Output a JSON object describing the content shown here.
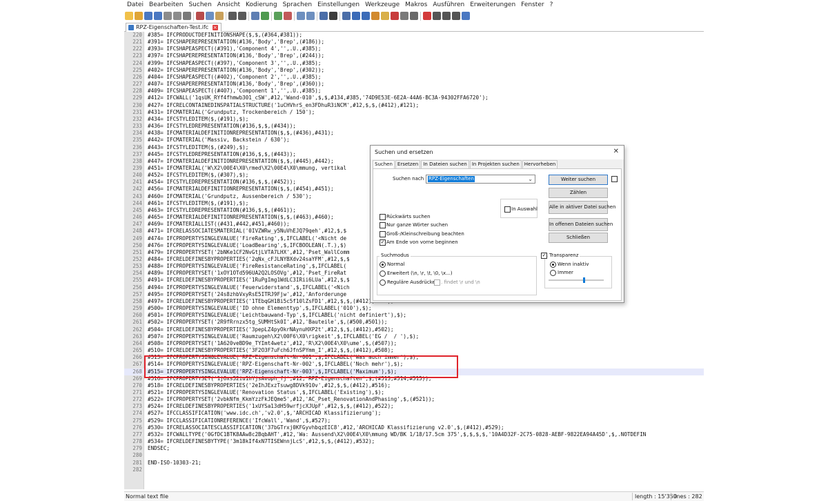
{
  "menubar": [
    "Datei",
    "Bearbeiten",
    "Suchen",
    "Ansicht",
    "Kodierung",
    "Sprachen",
    "Einstellungen",
    "Werkzeuge",
    "Makros",
    "Ausführen",
    "Erweiterungen",
    "Fenster",
    "?"
  ],
  "toolbar_icons": [
    {
      "name": "new-file-icon",
      "color": "#f1c14a"
    },
    {
      "name": "open-file-icon",
      "color": "#e0a536"
    },
    {
      "name": "save-icon",
      "color": "#4a78c2"
    },
    {
      "name": "save-all-icon",
      "color": "#4a78c2"
    },
    {
      "name": "close-icon",
      "color": "#8c8c8c"
    },
    {
      "name": "close-all-icon",
      "color": "#8c8c8c"
    },
    {
      "name": "print-icon",
      "color": "#7a7a7a"
    },
    {
      "name": "sep"
    },
    {
      "name": "cut-icon",
      "color": "#b84c4c"
    },
    {
      "name": "copy-icon",
      "color": "#6b8fc4"
    },
    {
      "name": "paste-icon",
      "color": "#c9a05a"
    },
    {
      "name": "sep"
    },
    {
      "name": "undo-icon",
      "color": "#5a5a5a"
    },
    {
      "name": "redo-icon",
      "color": "#5a5a5a"
    },
    {
      "name": "sep"
    },
    {
      "name": "find-icon",
      "color": "#5f7fb3"
    },
    {
      "name": "replace-icon",
      "color": "#4f9a4f"
    },
    {
      "name": "sep"
    },
    {
      "name": "zoom-in-icon",
      "color": "#5aa05a"
    },
    {
      "name": "zoom-out-icon",
      "color": "#c25a5a"
    },
    {
      "name": "sep"
    },
    {
      "name": "sync-vertical-icon",
      "color": "#6d8fbf"
    },
    {
      "name": "sync-horizontal-icon",
      "color": "#6d8fbf"
    },
    {
      "name": "sep"
    },
    {
      "name": "word-wrap-icon",
      "color": "#4b6ea8"
    },
    {
      "name": "show-all-chars-icon",
      "color": "#3c3c3c"
    },
    {
      "name": "sep"
    },
    {
      "name": "indent-guide-icon",
      "color": "#4b6ea8"
    },
    {
      "name": "udl-icon",
      "color": "#3c6cb8"
    },
    {
      "name": "doc-map-icon",
      "color": "#3c6cb8"
    },
    {
      "name": "function-list-icon",
      "color": "#d28a2e"
    },
    {
      "name": "folder-workspace-icon",
      "color": "#d9b04a"
    },
    {
      "name": "monitoring-icon",
      "color": "#c83c3c"
    },
    {
      "name": "panel-icon",
      "color": "#7a7a7a"
    },
    {
      "name": "eye-icon",
      "color": "#6a6a6a"
    },
    {
      "name": "sep"
    },
    {
      "name": "record-macro-icon",
      "color": "#d33a3a"
    },
    {
      "name": "stop-record-icon",
      "color": "#555555"
    },
    {
      "name": "play-macro-icon",
      "color": "#555555"
    },
    {
      "name": "play-multiple-icon",
      "color": "#555555"
    },
    {
      "name": "save-macro-icon",
      "color": "#4a78c2"
    }
  ],
  "tab": {
    "label": "RPZ-Eigenschaften-Test.ifc"
  },
  "editor": {
    "current_line": 268,
    "highlight_text": "RPZ-Eigenschaften",
    "lines": [
      {
        "n": "220",
        "t": "#385= IFCPRODUCTDEFINITIONSHAPE($,$,(#364,#381));"
      },
      {
        "n": "221",
        "t": "#391= IFCSHAPEREPRESENTATION(#136,'Body','Brep',(#186));"
      },
      {
        "n": "222",
        "t": "#393= IFCSHAPEASPECT((#391),'Component 4','',.U.,#385);"
      },
      {
        "n": "223",
        "t": "#397= IFCSHAPEREPRESENTATION(#136,'Body','Brep',(#244));"
      },
      {
        "n": "224",
        "t": "#399= IFCSHAPEASPECT((#397),'Component 3','',.U.,#385);"
      },
      {
        "n": "225",
        "t": "#402= IFCSHAPEREPRESENTATION(#136,'Body','Brep',(#302));"
      },
      {
        "n": "226",
        "t": "#404= IFCSHAPEASPECT((#402),'Component 2','',.U.,#385);"
      },
      {
        "n": "227",
        "t": "#407= IFCSHAPEREPRESENTATION(#136,'Body','Brep',(#360));"
      },
      {
        "n": "228",
        "t": "#409= IFCSHAPEASPECT((#407),'Component 1','',.U.,#385);"
      },
      {
        "n": "229",
        "t": "#412= IFCWALL('1qsUK_RYf4fhmwb301_cSW',#12,'Wand-010',$,$,#134,#385,'74D9E53E-6E2A-44A6-BC3A-94302FFA6720');"
      },
      {
        "n": "230",
        "t": "#427= IFCRELCONTAINEDINSPATIALSTRUCTURE('1uCHVhrS_en3FDhuR3iNCM',#12,$,$,(#412),#121);"
      },
      {
        "n": "231",
        "t": "#431= IFCMATERIAL('Grundputz, Trockenbereich / 150');"
      },
      {
        "n": "232",
        "t": "#434= IFCSTYLEDITEM($,(#191),$);"
      },
      {
        "n": "233",
        "t": "#436= IFCSTYLEDREPRESENTATION(#136,$,$,(#434));"
      },
      {
        "n": "234",
        "t": "#438= IFCMATERIALDEFINITIONREPRESENTATION($,$,(#436),#431);"
      },
      {
        "n": "235",
        "t": "#442= IFCMATERIAL('Massiv, Backstein / 630');"
      },
      {
        "n": "236",
        "t": "#443= IFCSTYLEDITEM($,(#249),$);"
      },
      {
        "n": "237",
        "t": "#445= IFCSTYLEDREPRESENTATION(#136,$,$,(#443));"
      },
      {
        "n": "238",
        "t": "#447= IFCMATERIALDEFINITIONREPRESENTATION($,$,(#445),#442);"
      },
      {
        "n": "239",
        "t": "#451= IFCMATERIAL('W\\X2\\00E4\\X0\\rmed\\X2\\00E4\\X0\\mmung, vertikal"
      },
      {
        "n": "240",
        "t": "#452= IFCSTYLEDITEM($,(#307),$);"
      },
      {
        "n": "241",
        "t": "#454= IFCSTYLEDREPRESENTATION(#136,$,$,(#452));"
      },
      {
        "n": "242",
        "t": "#456= IFCMATERIALDEFINITIONREPRESENTATION($,$,(#454),#451);"
      },
      {
        "n": "243",
        "t": "#460= IFCMATERIAL('Grundputz, Aussenbereich / 530');"
      },
      {
        "n": "244",
        "t": "#461= IFCSTYLEDITEM($,(#191),$);"
      },
      {
        "n": "245",
        "t": "#463= IFCSTYLEDREPRESENTATION(#136,$,$,(#461));"
      },
      {
        "n": "246",
        "t": "#465= IFCMATERIALDEFINITIONREPRESENTATION($,$,(#463),#460);"
      },
      {
        "n": "247",
        "t": "#469= IFCMATERIALLIST((#431,#442,#451,#460));"
      },
      {
        "n": "248",
        "t": "#471= IFCRELASSOCIATESMATERIAL('0IVZWRw_y5NuVhEJQ79qeh',#12,$,$"
      },
      {
        "n": "249",
        "t": "#474= IFCPROPERTYSINGLEVALUE('FireRating',$,IFCLABEL('<Nicht de"
      },
      {
        "n": "250",
        "t": "#476= IFCPROPERTYSINGLEVALUE('LoadBearing',$,IFCBOOLEAN(.T.),$)"
      },
      {
        "n": "251",
        "t": "#479= IFCPROPERTYSET('2bNKe1CF2NvGtjLVTA7LHX',#12,'Pset_WallComm"
      },
      {
        "n": "252",
        "t": "#484= IFCRELDEFINESBYPROPERTIES('2qNx_cFJLNYBXdv24saYFM',#12,$,$"
      },
      {
        "n": "253",
        "t": "#488= IFCPROPERTYSINGLEVALUE('FireResistanceRating',$,IFCLABEL("
      },
      {
        "n": "254",
        "t": "#489= IFCPROPERTYSET('1xOY1OTd596UA2Q2LOSOVg',#12,'Pset_FireRat"
      },
      {
        "n": "255",
        "t": "#491= IFCRELDEFINESBYPROPERTIES('1RuPgImg1WdLC3IRii6LUa',#12,$,$"
      },
      {
        "n": "256",
        "t": "#494= IFCPROPERTYSINGLEVALUE('Feuerwiderstand',$,IFCLABEL('<Nich"
      },
      {
        "n": "257",
        "t": "#495= IFCPROPERTYSET('24s8zhbVxyRsE5ITRJ9Fjw',#12,'Anforderunge"
      },
      {
        "n": "258",
        "t": "#497= IFCRELDEFINESBYPROPERTIES('1TEbqGH1Bi5c5f10lZsFD1',#12,$,$,(#412),#495);"
      },
      {
        "n": "259",
        "t": "#500= IFCPROPERTYSINGLEVALUE('ID ohne Elementtyp',$,IFCLABEL('010'),$);"
      },
      {
        "n": "260",
        "t": "#501= IFCPROPERTYSINGLEVALUE('Leichtbauwand-Typ',$,IFCLABEL('nicht definiert'),$);"
      },
      {
        "n": "261",
        "t": "#502= IFCPROPERTYSET('2R9fRrnzx5tg_SUMHtSk0I',#12,'Bauteile',$,(#500,#501));"
      },
      {
        "n": "262",
        "t": "#504= IFCRELDEFINESBYPROPERTIES('3pepLZ4pyOkrNAynuHXP2t',#12,$,$,(#412),#502);"
      },
      {
        "n": "263",
        "t": "#507= IFCPROPERTYSINGLEVALUE('Raumzugeh\\X2\\00F6\\X0\\rigkeit',$,IFCLABEL('EG /  / '),$);"
      },
      {
        "n": "264",
        "t": "#508= IFCPROPERTYSET('1A620veBD9e_TYImt4wetz',#12,'R\\X2\\00E4\\X0\\ume',$,(#507));"
      },
      {
        "n": "265",
        "t": "#510= IFCRELDEFINESBYPROPERTIES('3F2O3F7uFch6JfnSPYmm_I',#12,$,$,(#412),#508);"
      },
      {
        "n": "266",
        "t": "#513= IFCPROPERTYSINGLEVALUE('RPZ-Eigenschaft-Nr-001',$,IFCLABEL('Was auch immer'),$);"
      },
      {
        "n": "267",
        "t": "#514= IFCPROPERTYSINGLEVALUE('RPZ-Eigenschaft-Nr-002',$,IFCLABEL('Noch mehr'),$);"
      },
      {
        "n": "268",
        "t": "#515= IFCPROPERTYSINGLEVALUE('RPZ-Eigenschaft-Nr-003',$,IFCLABEL('Maximum'),$);"
      },
      {
        "n": "269",
        "t": "#516= IFCPROPERTYSET('1jOxs52iu1hYjsAvuph_fj',#12,'RPZ-Eigenschaften',$,(#513,#514,#515));"
      },
      {
        "n": "270",
        "t": "#518= IFCRELDEFINESBYPROPERTIES('2eIhJExzTsuwg8DVk910v',#12,$,$,(#412),#516);"
      },
      {
        "n": "271",
        "t": "#521= IFCPROPERTYSINGLEVALUE('Renovation Status',$,IFCLABEL('Existing'),$);"
      },
      {
        "n": "272",
        "t": "#522= IFCPROPERTYSET('2vbkNfm_KkmYzzFkJEQme5',#12,'AC_Pset_RenovationAndPhasing',$,(#521));"
      },
      {
        "n": "273",
        "t": "#524= IFCRELDEFINESBYPROPERTIES('1xUYSa13dH59wrfjcXJUpF',#12,$,$,(#412),#522);"
      },
      {
        "n": "274",
        "t": "#527= IFCCLASSIFICATION('www.idc.ch','v2.0',$,'ARCHICAD Klassifizierung');"
      },
      {
        "n": "275",
        "t": "#529= IFCCLASSIFICATIONREFERENCE('IfcWall','Wand',$,#527);"
      },
      {
        "n": "276",
        "t": "#530= IFCRELASSOCIATESCLASSIFICATION('37bGTrxj0KFGyvhbqzEIC8',#12,'ARCHICAD Klassifizierung v2.0',$,(#412),#529);"
      },
      {
        "n": "277",
        "t": "#532= IFCWALLTYPE('0GfDC1BTK8AAw8c2BqbAHT',#12,'Wa: Aussend\\X2\\00E4\\X0\\mmung WD/BK 1/18/17.5cm 375',$,$,$,$,'10A4D32F-2C75-0828-AEBF-9822EA94A45D',$,.NOTDEFIN"
      },
      {
        "n": "278",
        "t": "#534= IFCRELDEFINESBYTYPE('3m18kIf4xN7TISEWnnjLcS',#12,$,$,(#412),#532);"
      },
      {
        "n": "279",
        "t": "ENDSEC;"
      },
      {
        "n": "280",
        "t": ""
      },
      {
        "n": "281",
        "t": "END-ISO-10303-21;"
      },
      {
        "n": "282",
        "t": ""
      }
    ]
  },
  "status": {
    "left": "Normal text file",
    "length": "length : 15'350",
    "lines": "lines : 282"
  },
  "dialog": {
    "title": "Suchen und ersetzen",
    "close_glyph": "✕",
    "tabs": [
      "Suchen",
      "Ersetzen",
      "In Dateien suchen",
      "In Projekten suchen",
      "Hervorheben"
    ],
    "search_label": "Suchen nach :",
    "search_value": "RPZ-Eigenschaften",
    "in_selection": "In Auswahl",
    "buttons": {
      "find_next": "Weiter suchen",
      "count": "Zählen",
      "find_all_current": "Alle in aktiver Datei suchen",
      "find_all_open": "In offenen Dateien suchen",
      "close": "Schließen"
    },
    "options": {
      "backward": "Rückwärts suchen",
      "whole_word": "Nur ganze Wörter suchen",
      "match_case": "Groß-/Kleinschreibung beachten",
      "wrap": "Am Ende von vorne beginnen"
    },
    "search_mode": {
      "title": "Suchmodus",
      "normal": "Normal",
      "extended": "Erweitert (\\n, \\r, \\t, \\0, \\x...)",
      "regex": "Reguläre Ausdrücke",
      "dot_matches": ". findet \\r und \\n"
    },
    "transparency": {
      "title": "Transparenz",
      "on_lose_focus": "Wenn inaktiv",
      "always": "Immer"
    }
  }
}
